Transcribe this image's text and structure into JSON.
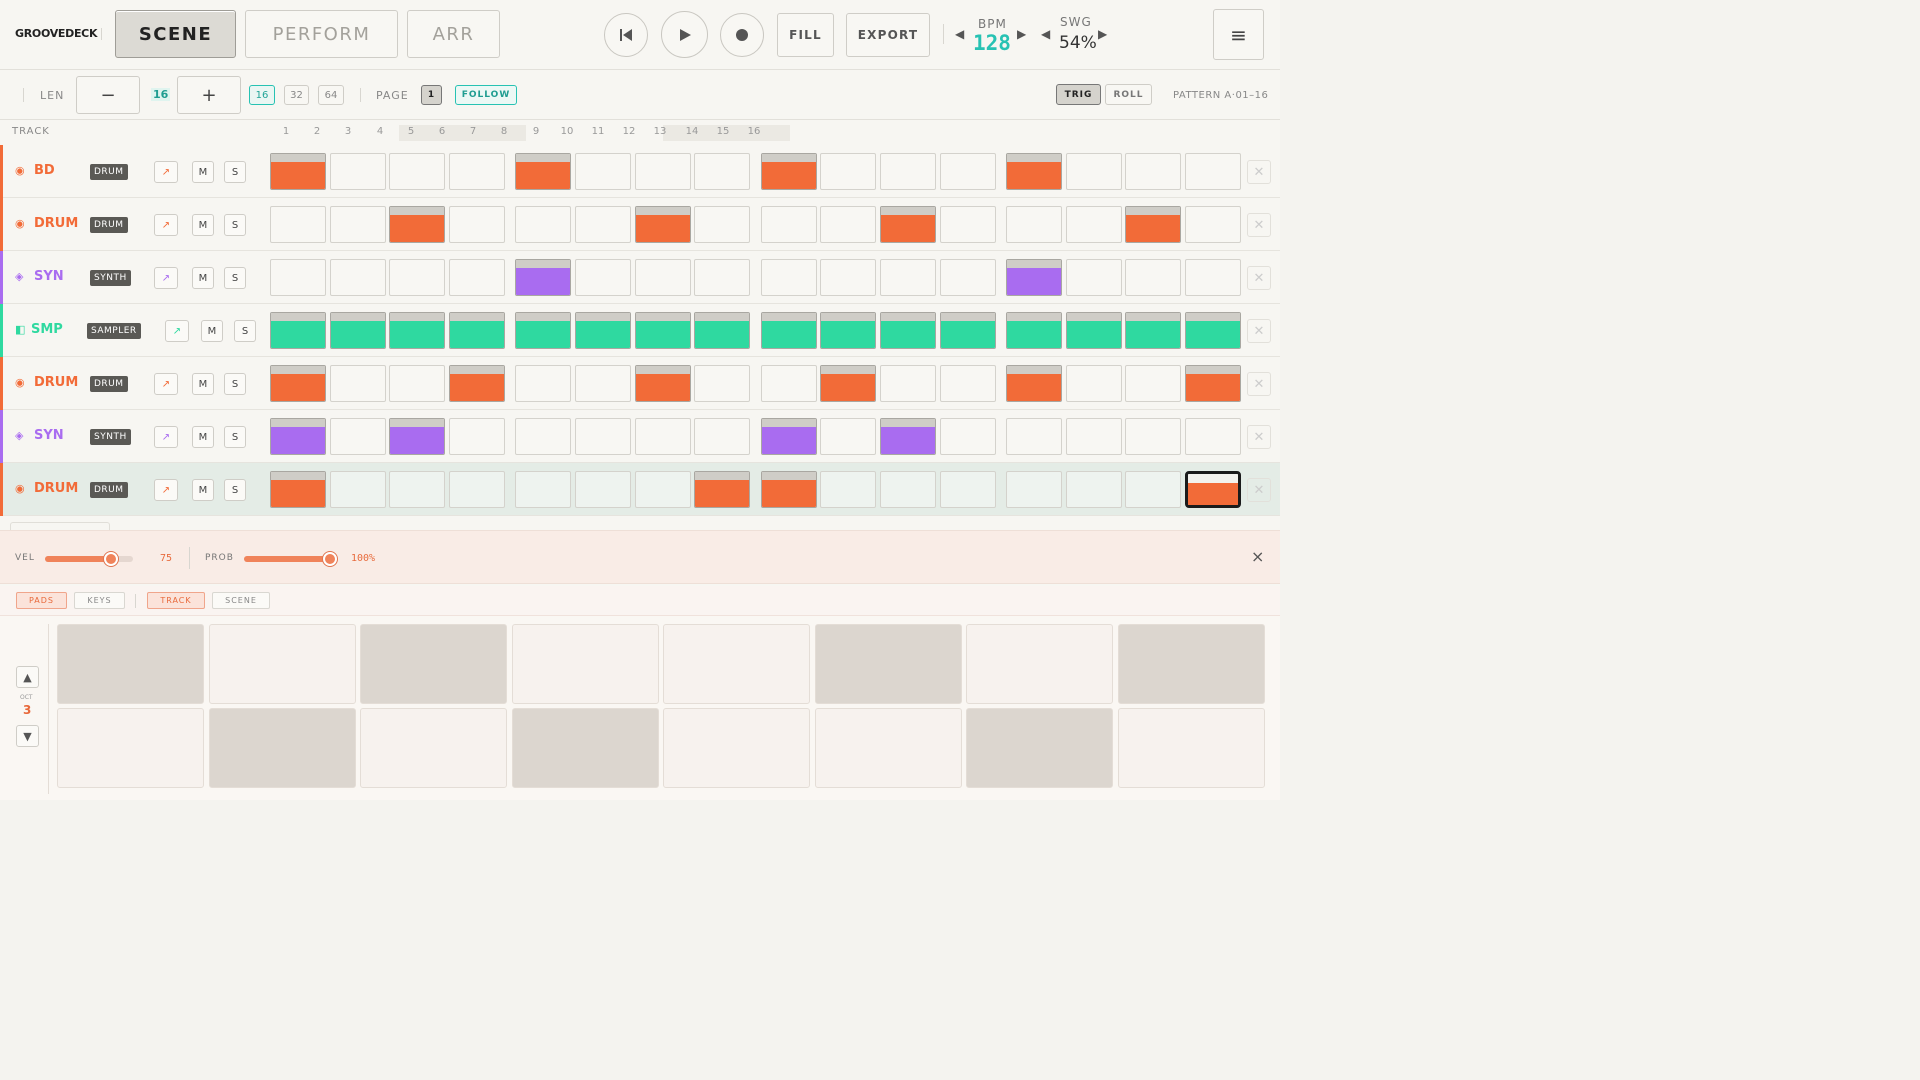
{
  "app": {
    "logo": "GROOVEDECK"
  },
  "modes": [
    {
      "label": "SCENE",
      "active": true
    },
    {
      "label": "PERFORM",
      "active": false
    },
    {
      "label": "ARR",
      "active": false
    }
  ],
  "transport": {
    "fill_label": "FILL",
    "export_label": "EXPORT"
  },
  "tempo": {
    "bpm_label": "BPM",
    "bpm": "128",
    "swing_label": "SWG",
    "swing": "54%"
  },
  "pattern_bar": {
    "len_label": "LEN",
    "len_minus": "−",
    "len_plus": "+",
    "len_value": "16",
    "len_options": [
      "16",
      "32",
      "64"
    ],
    "page_label": "PAGE",
    "page_value": "1",
    "follow_label": "FOLLOW",
    "trig_label": "TRIG",
    "roll_label": "ROLL",
    "pattern_name": "PATTERN A·01–16"
  },
  "grid_header": {
    "track_label": "TRACK",
    "steps": [
      "1",
      "2",
      "3",
      "4",
      "5",
      "6",
      "7",
      "8",
      "9",
      "10",
      "11",
      "12",
      "13",
      "14",
      "15",
      "16"
    ]
  },
  "colors": {
    "drum": "#f26b38",
    "synth": "#a96cf0",
    "sampler": "#2fd9a0",
    "teal": "#27c2b3"
  },
  "tracks": [
    {
      "name": "BD",
      "type": "DRUM",
      "kind": "drum",
      "icon": "◉",
      "mute": "M",
      "solo": "S",
      "steps": [
        1,
        0,
        0,
        0,
        1,
        0,
        0,
        0,
        1,
        0,
        0,
        0,
        1,
        0,
        0,
        0
      ]
    },
    {
      "name": "DRUM",
      "type": "DRUM",
      "kind": "drum",
      "icon": "◉",
      "mute": "M",
      "solo": "S",
      "steps": [
        0,
        0,
        1,
        0,
        0,
        0,
        1,
        0,
        0,
        0,
        1,
        0,
        0,
        0,
        1,
        0
      ]
    },
    {
      "name": "SYN",
      "type": "SYNTH",
      "kind": "synth",
      "icon": "◈",
      "mute": "M",
      "solo": "S",
      "steps": [
        0,
        0,
        0,
        0,
        1,
        0,
        0,
        0,
        0,
        0,
        0,
        0,
        1,
        0,
        0,
        0
      ]
    },
    {
      "name": "SMP",
      "type": "SAMPLER",
      "kind": "sampler",
      "icon": "◧",
      "mute": "M",
      "solo": "S",
      "steps": [
        1,
        1,
        1,
        1,
        1,
        1,
        1,
        1,
        1,
        1,
        1,
        1,
        1,
        1,
        1,
        1
      ]
    },
    {
      "name": "DRUM",
      "type": "DRUM",
      "kind": "drum",
      "icon": "◉",
      "mute": "M",
      "solo": "S",
      "steps": [
        1,
        0,
        0,
        1,
        0,
        0,
        1,
        0,
        0,
        1,
        0,
        0,
        1,
        0,
        0,
        1
      ]
    },
    {
      "name": "SYN",
      "type": "SYNTH",
      "kind": "synth",
      "icon": "◈",
      "mute": "M",
      "solo": "S",
      "steps": [
        1,
        0,
        1,
        0,
        0,
        0,
        0,
        0,
        1,
        0,
        1,
        0,
        0,
        0,
        0,
        0
      ]
    },
    {
      "name": "DRUM",
      "type": "DRUM",
      "kind": "drum",
      "icon": "◉",
      "mute": "M",
      "solo": "S",
      "steps": [
        1,
        0,
        0,
        0,
        0,
        0,
        0,
        1,
        1,
        0,
        0,
        0,
        0,
        0,
        0,
        1
      ],
      "selected": true,
      "cursor_step": 16
    }
  ],
  "step_params": {
    "vel_label": "VEL",
    "vel_value": "75",
    "vel_level": 0.75,
    "prob_label": "PROB",
    "prob_value": "100%",
    "prob_level": 1.0,
    "close": "×"
  },
  "keypad": {
    "tabs": [
      {
        "label": "PADS",
        "on": true
      },
      {
        "label": "KEYS",
        "on": false
      },
      {
        "label": "TRACK",
        "on": true
      },
      {
        "label": "SCENE",
        "on": false
      }
    ],
    "oct_label": "OCT",
    "oct_value": "3",
    "top_row": [
      {
        "dark": true
      },
      {
        "dark": false
      },
      {
        "dark": true
      },
      {
        "dark": false
      },
      {
        "dark": false
      },
      {
        "dark": true
      },
      {
        "dark": false
      },
      {
        "dark": true
      }
    ],
    "bottom_row": [
      {
        "dark": false
      },
      {
        "dark": true
      },
      {
        "dark": false
      },
      {
        "dark": true
      },
      {
        "dark": false
      },
      {
        "dark": false
      },
      {
        "dark": true
      },
      {
        "dark": false
      }
    ]
  }
}
